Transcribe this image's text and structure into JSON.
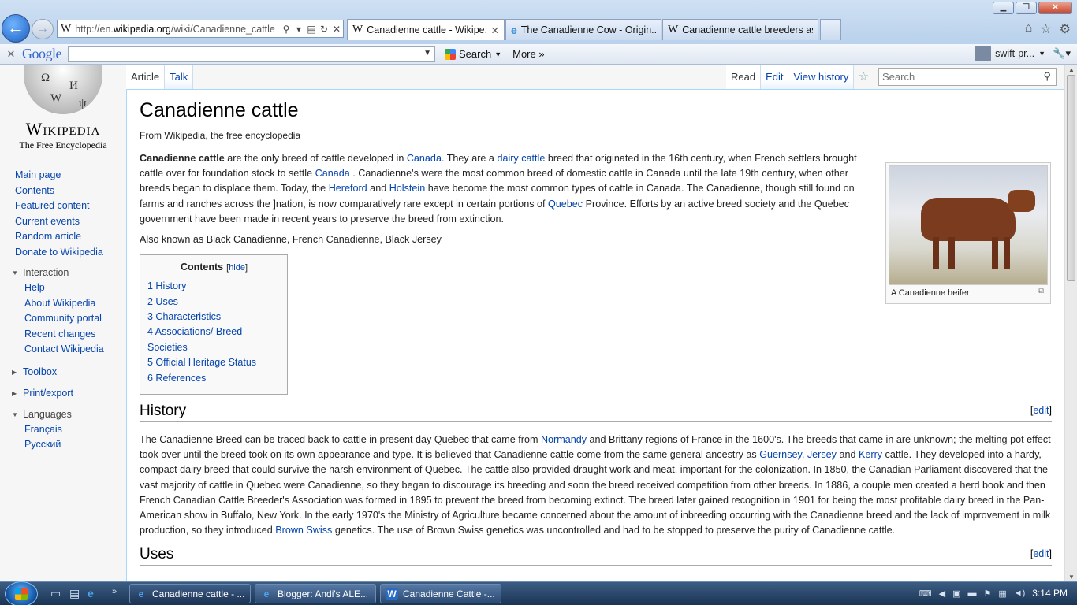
{
  "browser": {
    "url_prefix": "http://en.",
    "url_domain": "wikipedia.org",
    "url_path": "/wiki/Canadienne_cattle",
    "tabs": [
      {
        "label": "Canadienne cattle - Wikipe...",
        "icon": "W",
        "active": true
      },
      {
        "label": "The Canadienne Cow - Origin...",
        "icon": "e",
        "active": false
      },
      {
        "label": "Canadienne cattle breeders as...",
        "icon": "W",
        "active": false
      }
    ]
  },
  "google_bar": {
    "logo": "Google",
    "search_label": "Search",
    "more_label": "More",
    "user": "swift-pr..."
  },
  "wiki": {
    "logo_wordmark": "Wikipedia",
    "logo_tagline": "The Free Encyclopedia",
    "nav": [
      "Main page",
      "Contents",
      "Featured content",
      "Current events",
      "Random article",
      "Donate to Wikipedia"
    ],
    "interaction_heading": "Interaction",
    "interaction": [
      "Help",
      "About Wikipedia",
      "Community portal",
      "Recent changes",
      "Contact Wikipedia"
    ],
    "toolbox": "Toolbox",
    "print_export": "Print/export",
    "languages_heading": "Languages",
    "languages": [
      "Français",
      "Русский"
    ],
    "tabs_left": [
      "Article",
      "Talk"
    ],
    "tabs_right": [
      "Read",
      "Edit",
      "View history"
    ],
    "search_placeholder": "Search"
  },
  "article": {
    "title": "Canadienne cattle",
    "site_sub": "From Wikipedia, the free encyclopedia",
    "intro": {
      "bold": "Canadienne cattle",
      "t1": " are the only breed of cattle developed in ",
      "l1": "Canada",
      "t2": ". They are a ",
      "l2": "dairy cattle",
      "t3": " breed that originated in the 16th century, when French settlers brought cattle over for foundation stock to settle ",
      "l3": "Canada",
      "t4": " . Canadienne's were the most common breed of domestic cattle in Canada until the late 19th century, when other breeds began to displace them. Today, the ",
      "l4": "Hereford",
      "t5": " and ",
      "l5": "Holstein",
      "t6": " have become the most common types of cattle in Canada. The Canadienne, though still found on farms and ranches across the ]nation, is now comparatively rare except in certain portions of ",
      "l6": "Quebec",
      "t7": " Province. Efforts by an active breed society and the Quebec government have been made in recent years to preserve the breed from extinction."
    },
    "aka": "Also known as Black Canadienne, French Canadienne, Black Jersey",
    "thumb_caption": "A Canadienne heifer",
    "toc": {
      "title": "Contents",
      "hide": "hide",
      "items": [
        "1 History",
        "2 Uses",
        "3 Characteristics",
        "4 Associations/ Breed Societies",
        "5 Official Heritage Status",
        "6 References"
      ]
    },
    "history": {
      "heading": "History",
      "edit": "edit",
      "t1": "The Canadienne Breed can be traced back to cattle in present day Quebec that came from ",
      "l1": "Normandy",
      "t2": " and Brittany regions of France in the 1600's. The breeds that came in are unknown; the melting pot effect took over until the breed took on its own appearance and type. It is believed that Canadienne cattle come from the same general ancestry as ",
      "l2": "Guernsey",
      "t3": ", ",
      "l3": "Jersey",
      "t4": " and ",
      "l4": "Kerry",
      "t5": " cattle. They developed into a hardy, compact dairy breed that could survive the harsh environment of Quebec. The cattle also provided draught work and meat, important for the colonization. In 1850, the Canadian Parliament discovered that the vast majority of cattle in Quebec were Canadienne, so they began to discourage its breeding and soon the breed received competition from other breeds. In 1886, a couple men created a herd book and then French Canadian Cattle Breeder's Association was formed in 1895 to prevent the breed from becoming extinct. The breed later gained recognition in 1901 for being the most profitable dairy breed in the Pan-American show in Buffalo, New York. In the early 1970's the Ministry of Agriculture became concerned about the amount of inbreeding occurring with the Canadienne breed and the lack of improvement in milk production, so they introduced ",
      "l5": "Brown Swiss",
      "t6": " genetics. The use of Brown Swiss genetics was uncontrolled and had to be stopped to preserve the purity of Canadienne cattle."
    },
    "uses": {
      "heading": "Uses",
      "edit": "edit"
    }
  },
  "taskbar": {
    "tasks": [
      {
        "label": "Canadienne cattle - ...",
        "icon": "ie"
      },
      {
        "label": "Blogger: Andi's ALE...",
        "icon": "ie"
      },
      {
        "label": "Canadienne Cattle -...",
        "icon": "word"
      }
    ],
    "clock": "3:14 PM"
  }
}
